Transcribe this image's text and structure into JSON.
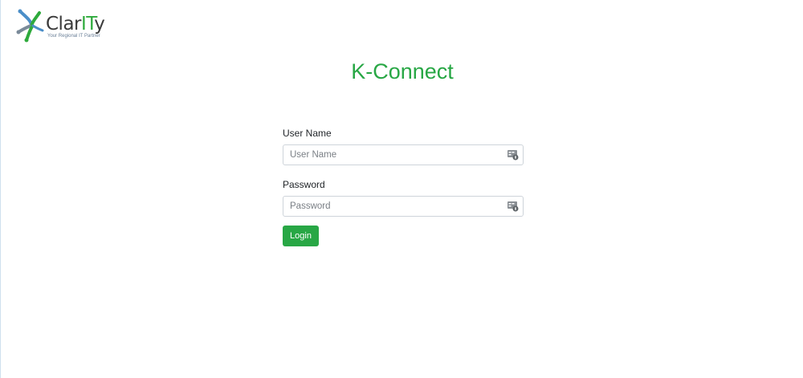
{
  "brand": {
    "name_prefix": "Clar",
    "name_it": "IT",
    "name_suffix": "y",
    "tagline": "Your Regional IT Partner",
    "colors": {
      "green": "#2eaa3c",
      "blue": "#4b8ec8",
      "gray": "#3a3a3a"
    }
  },
  "page": {
    "title": "K-Connect",
    "accent_color": "#28a745"
  },
  "form": {
    "username": {
      "label": "User Name",
      "placeholder": "User Name",
      "value": "",
      "icon": "autofill-key-icon"
    },
    "password": {
      "label": "Password",
      "placeholder": "Password",
      "value": "",
      "icon": "autofill-key-icon"
    },
    "login_label": "Login"
  }
}
